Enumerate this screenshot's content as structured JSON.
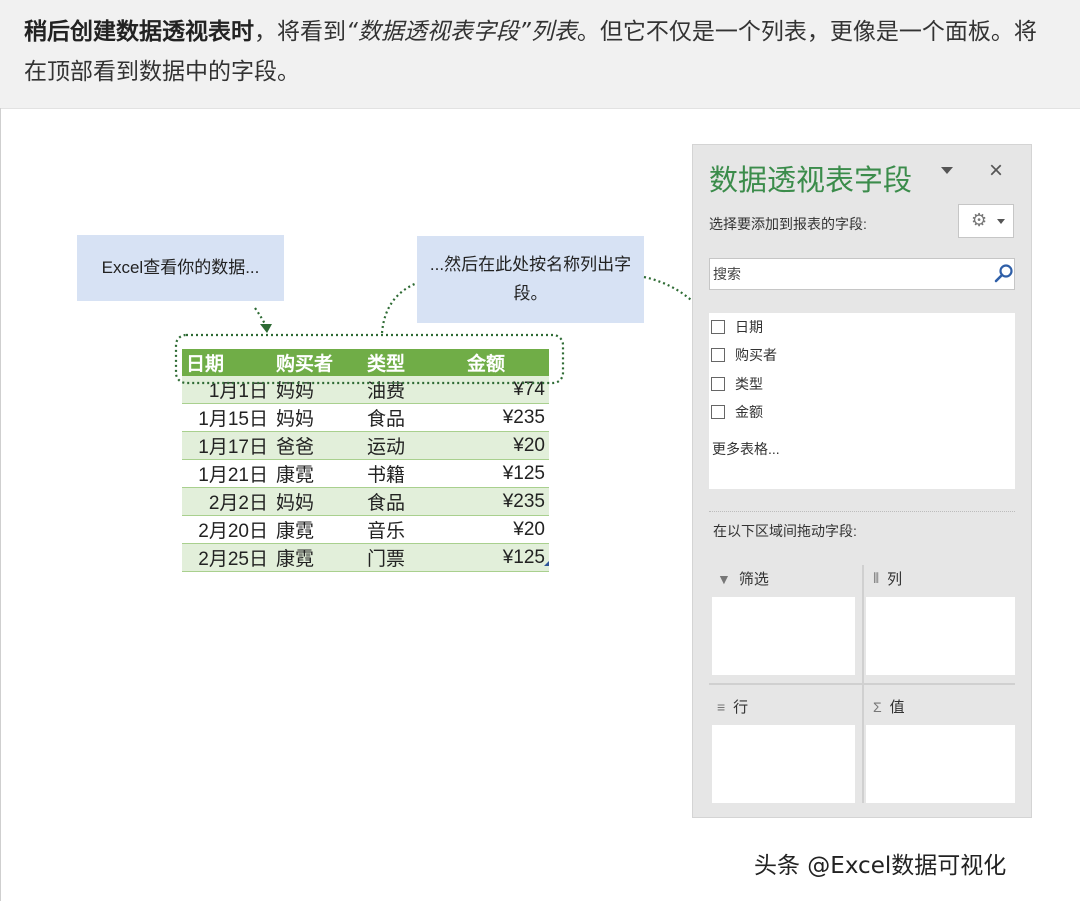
{
  "header": {
    "bold_text": "稍后创建数据透视表时",
    "text_part1": "，将看到",
    "italic_text": "“数据透视表字段”列表",
    "text_part2": "。但它不仅是一个列表，更像是一个面板。将在顶部看到数据中的字段。"
  },
  "callouts": {
    "left": "Excel查看你的数据...",
    "right": "...然后在此处按名称列出字段。"
  },
  "table": {
    "headers": [
      "日期",
      "购买者",
      "类型",
      "金额"
    ],
    "rows": [
      [
        "1月1日",
        "妈妈",
        "油费",
        "¥74"
      ],
      [
        "1月15日",
        "妈妈",
        "食品",
        "¥235"
      ],
      [
        "1月17日",
        "爸爸",
        "运动",
        "¥20"
      ],
      [
        "1月21日",
        "康霓",
        "书籍",
        "¥125"
      ],
      [
        "2月2日",
        "妈妈",
        "食品",
        "¥235"
      ],
      [
        "2月20日",
        "康霓",
        "音乐",
        "¥20"
      ],
      [
        "2月25日",
        "康霓",
        "门票",
        "¥125"
      ]
    ]
  },
  "panel": {
    "title": "数据透视表字段",
    "subtitle": "选择要添加到报表的字段:",
    "close_glyph": "×",
    "search_placeholder": "搜索",
    "fields": [
      "日期",
      "购买者",
      "类型",
      "金额"
    ],
    "more_tables": "更多表格...",
    "drag_label": "在以下区域间拖动字段:",
    "areas": {
      "filter": "筛选",
      "columns": "列",
      "rows": "行",
      "values": "值"
    }
  },
  "watermark": "头条 @Excel数据可视化",
  "colors": {
    "table_header": "#70ad47",
    "table_band": "#e2efda",
    "callout_bg": "#d7e2f4",
    "panel_title": "#3b8c4b",
    "connector": "#2e6b34"
  }
}
